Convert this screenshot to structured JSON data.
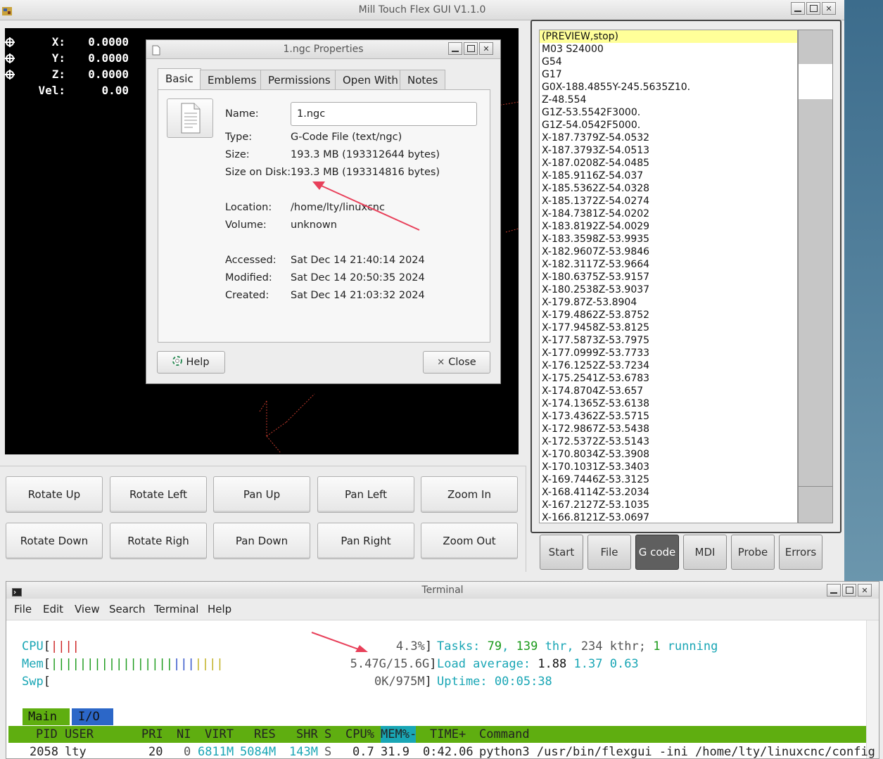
{
  "main_window": {
    "title": "Mill Touch Flex GUI V1.1.0"
  },
  "dro": [
    {
      "label": "X:",
      "value": "0.0000"
    },
    {
      "label": "Y:",
      "value": "0.0000"
    },
    {
      "label": "Z:",
      "value": "0.0000"
    },
    {
      "label": "Vel:",
      "value": "0.00"
    }
  ],
  "view_controls": [
    "Rotate Up",
    "Rotate Left",
    "Pan Up",
    "Pan Left",
    "Zoom In",
    "Rotate Down",
    "Rotate Righ",
    "Pan Down",
    "Pan Right",
    "Zoom Out"
  ],
  "gcode": {
    "lines": [
      "(PREVIEW,stop)",
      "M03 S24000",
      "G54",
      "G17",
      "G0X-188.4855Y-245.5635Z10.",
      "Z-48.554",
      "G1Z-53.5542F3000.",
      "G1Z-54.0542F5000.",
      "X-187.7379Z-54.0532",
      "X-187.3793Z-54.0513",
      "X-187.0208Z-54.0485",
      "X-185.9116Z-54.037",
      "X-185.5362Z-54.0328",
      "X-185.1372Z-54.0274",
      "X-184.7381Z-54.0202",
      "X-183.8192Z-54.0029",
      "X-183.3598Z-53.9935",
      "X-182.9607Z-53.9846",
      "X-182.3117Z-53.9664",
      "X-180.6375Z-53.9157",
      "X-180.2538Z-53.9037",
      "X-179.87Z-53.8904",
      "X-179.4862Z-53.8752",
      "X-177.9458Z-53.8125",
      "X-177.5873Z-53.7975",
      "X-177.0999Z-53.7733",
      "X-176.1252Z-53.7234",
      "X-175.2541Z-53.6783",
      "X-174.8704Z-53.657",
      "X-174.1365Z-53.6138",
      "X-173.4362Z-53.5715",
      "X-172.9867Z-53.5438",
      "X-172.5372Z-53.5143",
      "X-170.8034Z-53.3908",
      "X-170.1031Z-53.3403",
      "X-169.7446Z-53.3125",
      "X-168.4114Z-53.2034",
      "X-167.2127Z-53.1035",
      "X-166.8121Z-53.0697"
    ],
    "highlight_index": 0
  },
  "tabs": [
    "Start",
    "File",
    "G code",
    "MDI",
    "Probe",
    "Errors"
  ],
  "active_tab": "G code",
  "properties_dialog": {
    "title": "1.ngc Properties",
    "tabs": [
      "Basic",
      "Emblems",
      "Permissions",
      "Open With",
      "Notes"
    ],
    "active_tab": "Basic",
    "name_label": "Name:",
    "name_value": "1.ngc",
    "rows": [
      {
        "label": "Type:",
        "value": "G-Code File (text/ngc)"
      },
      {
        "label": "Size:",
        "value": "193.3 MB (193312644 bytes)"
      },
      {
        "label": "Size on Disk:",
        "value": "193.3 MB (193314816 bytes)"
      },
      {
        "label": "Location:",
        "value": "/home/lty/linuxcnc"
      },
      {
        "label": "Volume:",
        "value": "unknown"
      },
      {
        "label": "Accessed:",
        "value": "Sat Dec 14 21:40:14 2024"
      },
      {
        "label": "Modified:",
        "value": "Sat Dec 14 20:50:35 2024"
      },
      {
        "label": "Created:",
        "value": "Sat Dec 14 21:03:32 2024"
      }
    ],
    "help_label": "Help",
    "close_label": "Close"
  },
  "terminal": {
    "title": "Terminal",
    "menu": [
      "File",
      "Edit",
      "View",
      "Search",
      "Terminal",
      "Help"
    ],
    "htop": {
      "cpu_label": "CPU",
      "cpu_value": "4.3%",
      "mem_label": "Mem",
      "mem_value": "5.47G/15.6G",
      "swp_label": "Swp",
      "swp_value": "0K/975M",
      "tasks_label": "Tasks:",
      "tasks": "79",
      "thr": "139",
      "thr_label": "thr,",
      "kthr": "234 kthr;",
      "running": "1",
      "running_label": "running",
      "load_label": "Load average:",
      "load1": "1.88",
      "load5": "1.37",
      "load15": "0.63",
      "uptime_label": "Uptime:",
      "uptime": "00:05:38",
      "tab_main": "Main",
      "tab_io": "I/O",
      "columns": [
        "PID",
        "USER",
        "PRI",
        "NI",
        "VIRT",
        "RES",
        "SHR",
        "S",
        "CPU%",
        "MEM%-",
        "TIME+",
        "Command"
      ],
      "row": {
        "pid": "2058",
        "user": "lty",
        "pri": "20",
        "ni": "0",
        "virt": "6811M",
        "res": "5084M",
        "shr": "143M",
        "s": "S",
        "cpu": "0.7",
        "mem": "31.9",
        "time": "0:42.06",
        "command": "python3 /usr/bin/flexgui -ini /home/lty/linuxcnc/config"
      }
    }
  },
  "colors": {
    "preview_bg": "#000000",
    "highlight": "#ffff99",
    "htop_header_green": "#5fae10",
    "htop_cyan": "#19a6b5",
    "annotation_arrow": "#e8405a"
  }
}
